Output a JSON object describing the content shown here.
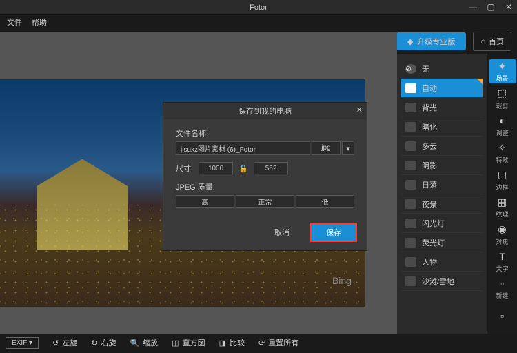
{
  "app": {
    "title": "Fotor"
  },
  "menu": {
    "file": "文件",
    "help": "帮助"
  },
  "topbar": {
    "upgrade": "升级专业版",
    "home": "首页"
  },
  "watermark": "Bing",
  "sidelist": {
    "items": [
      {
        "label": "无"
      },
      {
        "label": "自动"
      },
      {
        "label": "背光"
      },
      {
        "label": "暗化"
      },
      {
        "label": "多云"
      },
      {
        "label": "阴影"
      },
      {
        "label": "日落"
      },
      {
        "label": "夜景"
      },
      {
        "label": "闪光灯"
      },
      {
        "label": "荧光灯"
      },
      {
        "label": "人物"
      },
      {
        "label": "沙滩/雪地"
      }
    ]
  },
  "tools": {
    "items": [
      {
        "label": "场景",
        "glyph": "✦"
      },
      {
        "label": "裁剪",
        "glyph": "⬚"
      },
      {
        "label": "调整",
        "glyph": "◐"
      },
      {
        "label": "特效",
        "glyph": "✧"
      },
      {
        "label": "边框",
        "glyph": "▢"
      },
      {
        "label": "纹理",
        "glyph": "▦"
      },
      {
        "label": "对焦",
        "glyph": "◉"
      },
      {
        "label": "文字",
        "glyph": "T"
      },
      {
        "label": "新建",
        "glyph": "▫"
      },
      {
        "label": "",
        "glyph": "▫"
      }
    ]
  },
  "bottombar": {
    "exif": "EXIF ▾",
    "rotate_left": "左旋",
    "rotate_right": "右旋",
    "zoom": "缩放",
    "histogram": "直方图",
    "compare": "比较",
    "reset": "重置所有"
  },
  "dialog": {
    "title": "保存到我的电脑",
    "filename_label": "文件名称:",
    "filename_value": "jisuxz图片素材 (6)_Fotor",
    "extension": "jpg",
    "size_label": "尺寸:",
    "width": "1000",
    "height": "562",
    "quality_label": "JPEG 质量:",
    "quality": {
      "high": "高",
      "normal": "正常",
      "low": "低"
    },
    "cancel": "取消",
    "save": "保存"
  }
}
